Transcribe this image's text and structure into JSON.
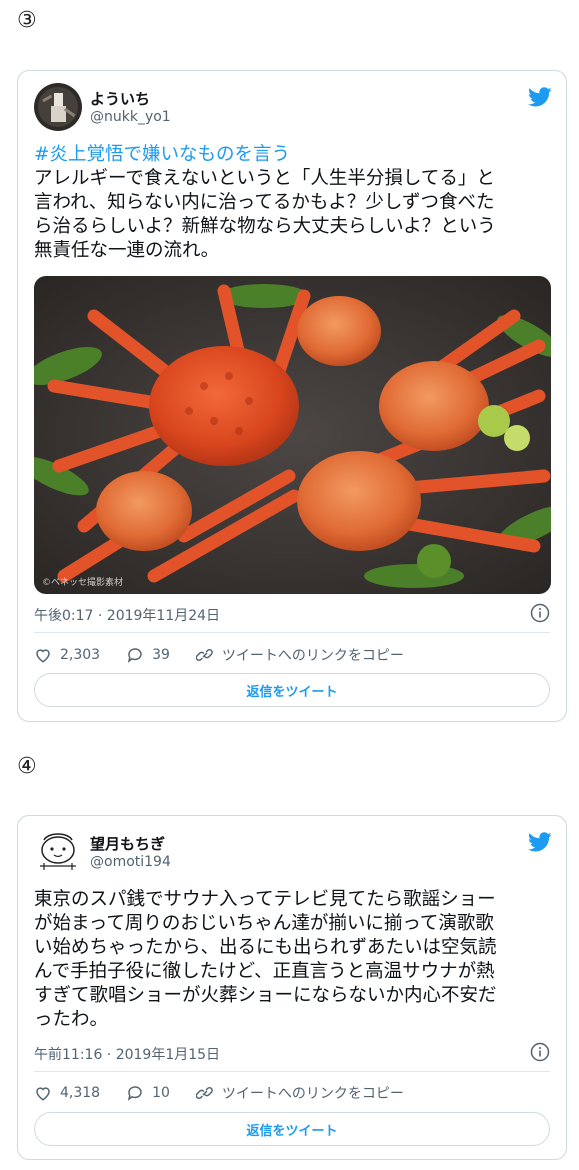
{
  "sections": [
    {
      "number": "③",
      "tweet": {
        "name": "よういち",
        "handle": "@nukk_yo1",
        "hashtag": "#炎上覚悟で嫌いなものを言う",
        "body": "アレルギーで食えないというと「人生半分損してる」と\n言われ、知らない内に治ってるかもよ？少しずつ食べた\nら治るらしいよ？新鮮な物なら大丈夫らしいよ？という\n無責任な一連の流れ。",
        "photo_watermark": "©ベネッセ撮影素材",
        "timestamp": "午後0:17 · 2019年11月24日",
        "likes": "2,303",
        "replies": "39",
        "copy_link": "ツイートへのリンクをコピー",
        "reply_button": "返信をツイート"
      }
    },
    {
      "number": "④",
      "tweet": {
        "name": "望月もちぎ",
        "handle": "@omoti194",
        "body": "東京のスパ銭でサウナ入ってテレビ見てたら歌謡ショー\nが始まって周りのおじいちゃん達が揃いに揃って演歌歌\nい始めちゃったから、出るにも出られずあたいは空気読\nんで手拍子役に徹したけど、正直言うと高温サウナが熱\nすぎて歌唱ショーが火葬ショーにならないか内心不安だ\nったわ。",
        "timestamp": "午前11:16 · 2019年1月15日",
        "likes": "4,318",
        "replies": "10",
        "copy_link": "ツイートへのリンクをコピー",
        "reply_button": "返信をツイート"
      }
    }
  ],
  "icons": {
    "brand": "twitter-bird-icon",
    "like": "heart-icon",
    "reply": "reply-bubble-icon",
    "link": "link-icon",
    "info": "info-icon"
  },
  "colors": {
    "accent": "#1d9bf0",
    "text": "#0f1419",
    "muted": "#536471",
    "border": "#cfd9de"
  }
}
